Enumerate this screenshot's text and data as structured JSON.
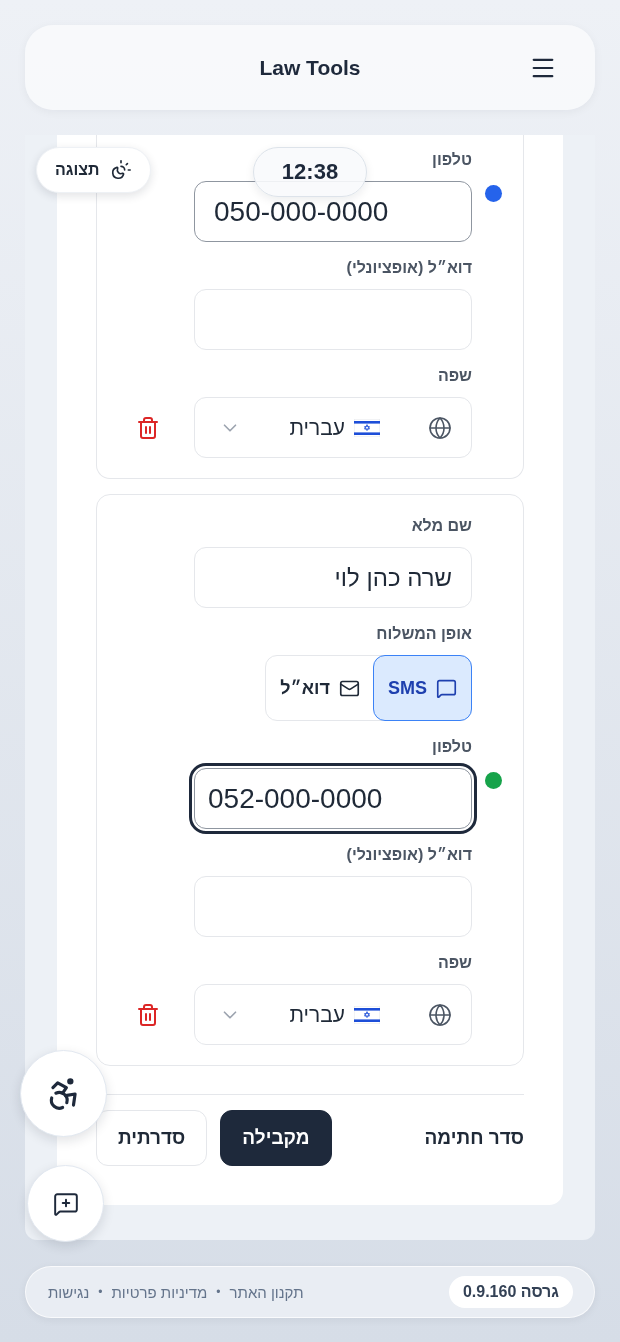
{
  "header": {
    "title": "Law Tools"
  },
  "display_button": {
    "label": "תצוגה"
  },
  "clock": {
    "time": "12:38"
  },
  "signers": [
    {
      "color": "#2563eb",
      "fields": [
        {
          "kind": "phone",
          "label": "טלפון",
          "value": "050-000-0000",
          "focused": false
        },
        {
          "kind": "text",
          "label": "דוא״ל (אופציונלי)",
          "focused": false
        },
        {
          "kind": "select",
          "label": "שפה",
          "value": "עברית"
        }
      ]
    },
    {
      "color": "#16a34a",
      "fields": [
        {
          "kind": "text",
          "label": "שם מלא",
          "value": "שרה כהן לוי",
          "focused": false
        },
        {
          "kind": "choice",
          "label": "אופן המשלוח",
          "options": [
            {
              "kind": "sms",
              "label": "SMS",
              "selected": true
            },
            {
              "kind": "email",
              "label": "דוא״ל",
              "selected": false
            }
          ]
        },
        {
          "kind": "phone",
          "label": "טלפון",
          "value": "052-000-0000",
          "focused": true
        },
        {
          "kind": "text",
          "label": "דוא״ל (אופציונלי)",
          "focused": false
        },
        {
          "kind": "select",
          "label": "שפה",
          "value": "עברית"
        }
      ]
    }
  ],
  "signing_order": {
    "label": "סדר חתימה",
    "options": [
      {
        "label": "מקבילה",
        "selected": true
      },
      {
        "label": "סדרתית",
        "selected": false
      }
    ]
  },
  "footer": {
    "version": "גרסה 0.9.160",
    "items": [
      {
        "kind": "link",
        "label": "תקנון האתר"
      },
      {
        "kind": "separator",
        "label": "•"
      },
      {
        "kind": "link",
        "label": "מדיניות פרטיות"
      },
      {
        "kind": "separator",
        "label": "•"
      },
      {
        "kind": "link",
        "label": "נגישות"
      }
    ]
  }
}
